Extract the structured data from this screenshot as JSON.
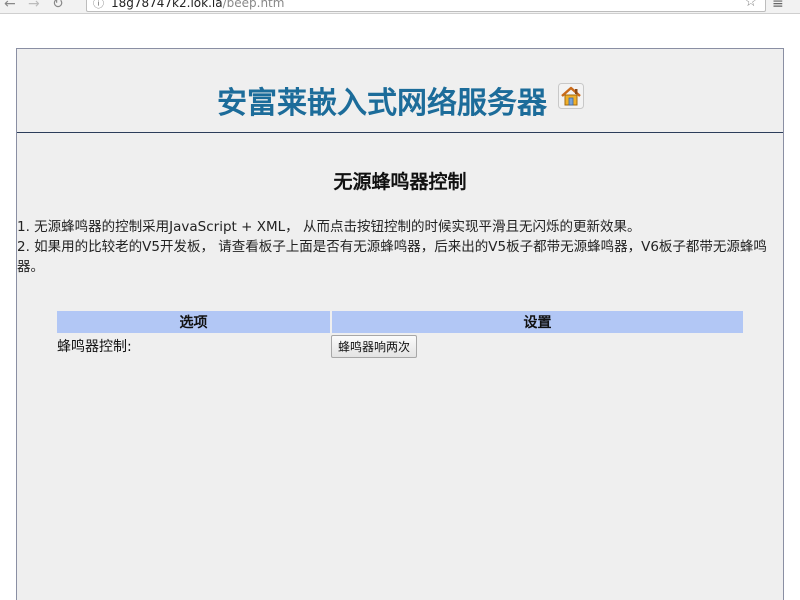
{
  "browser": {
    "url_host": "18g78747k2.iok.la",
    "url_path": "/beep.htm",
    "back_glyph": "←",
    "forward_glyph": "→",
    "reload_glyph": "↻",
    "star_glyph": "☆",
    "menu_glyph": "≡"
  },
  "header": {
    "title": "安富莱嵌入式网络服务器",
    "icon": "home-icon"
  },
  "section": {
    "title": "无源蜂鸣器控制",
    "paragraph1": "1. 无源蜂鸣器的控制采用JavaScript + XML， 从而点击按钮控制的时候实现平滑且无闪烁的更新效果。",
    "paragraph2": "2. 如果用的比较老的V5开发板， 请查看板子上面是否有无源蜂鸣器，后来出的V5板子都带无源蜂鸣器，V6板子都带无源蜂鸣器。"
  },
  "table": {
    "headers": [
      "选项",
      "设置"
    ],
    "rows": [
      {
        "label": "蜂鸣器控制:",
        "button": "蜂鸣器响两次"
      }
    ]
  },
  "colors": {
    "title": "#1c6c9a",
    "table_header": "#b2c7f5",
    "page_bg": "#efefef"
  }
}
